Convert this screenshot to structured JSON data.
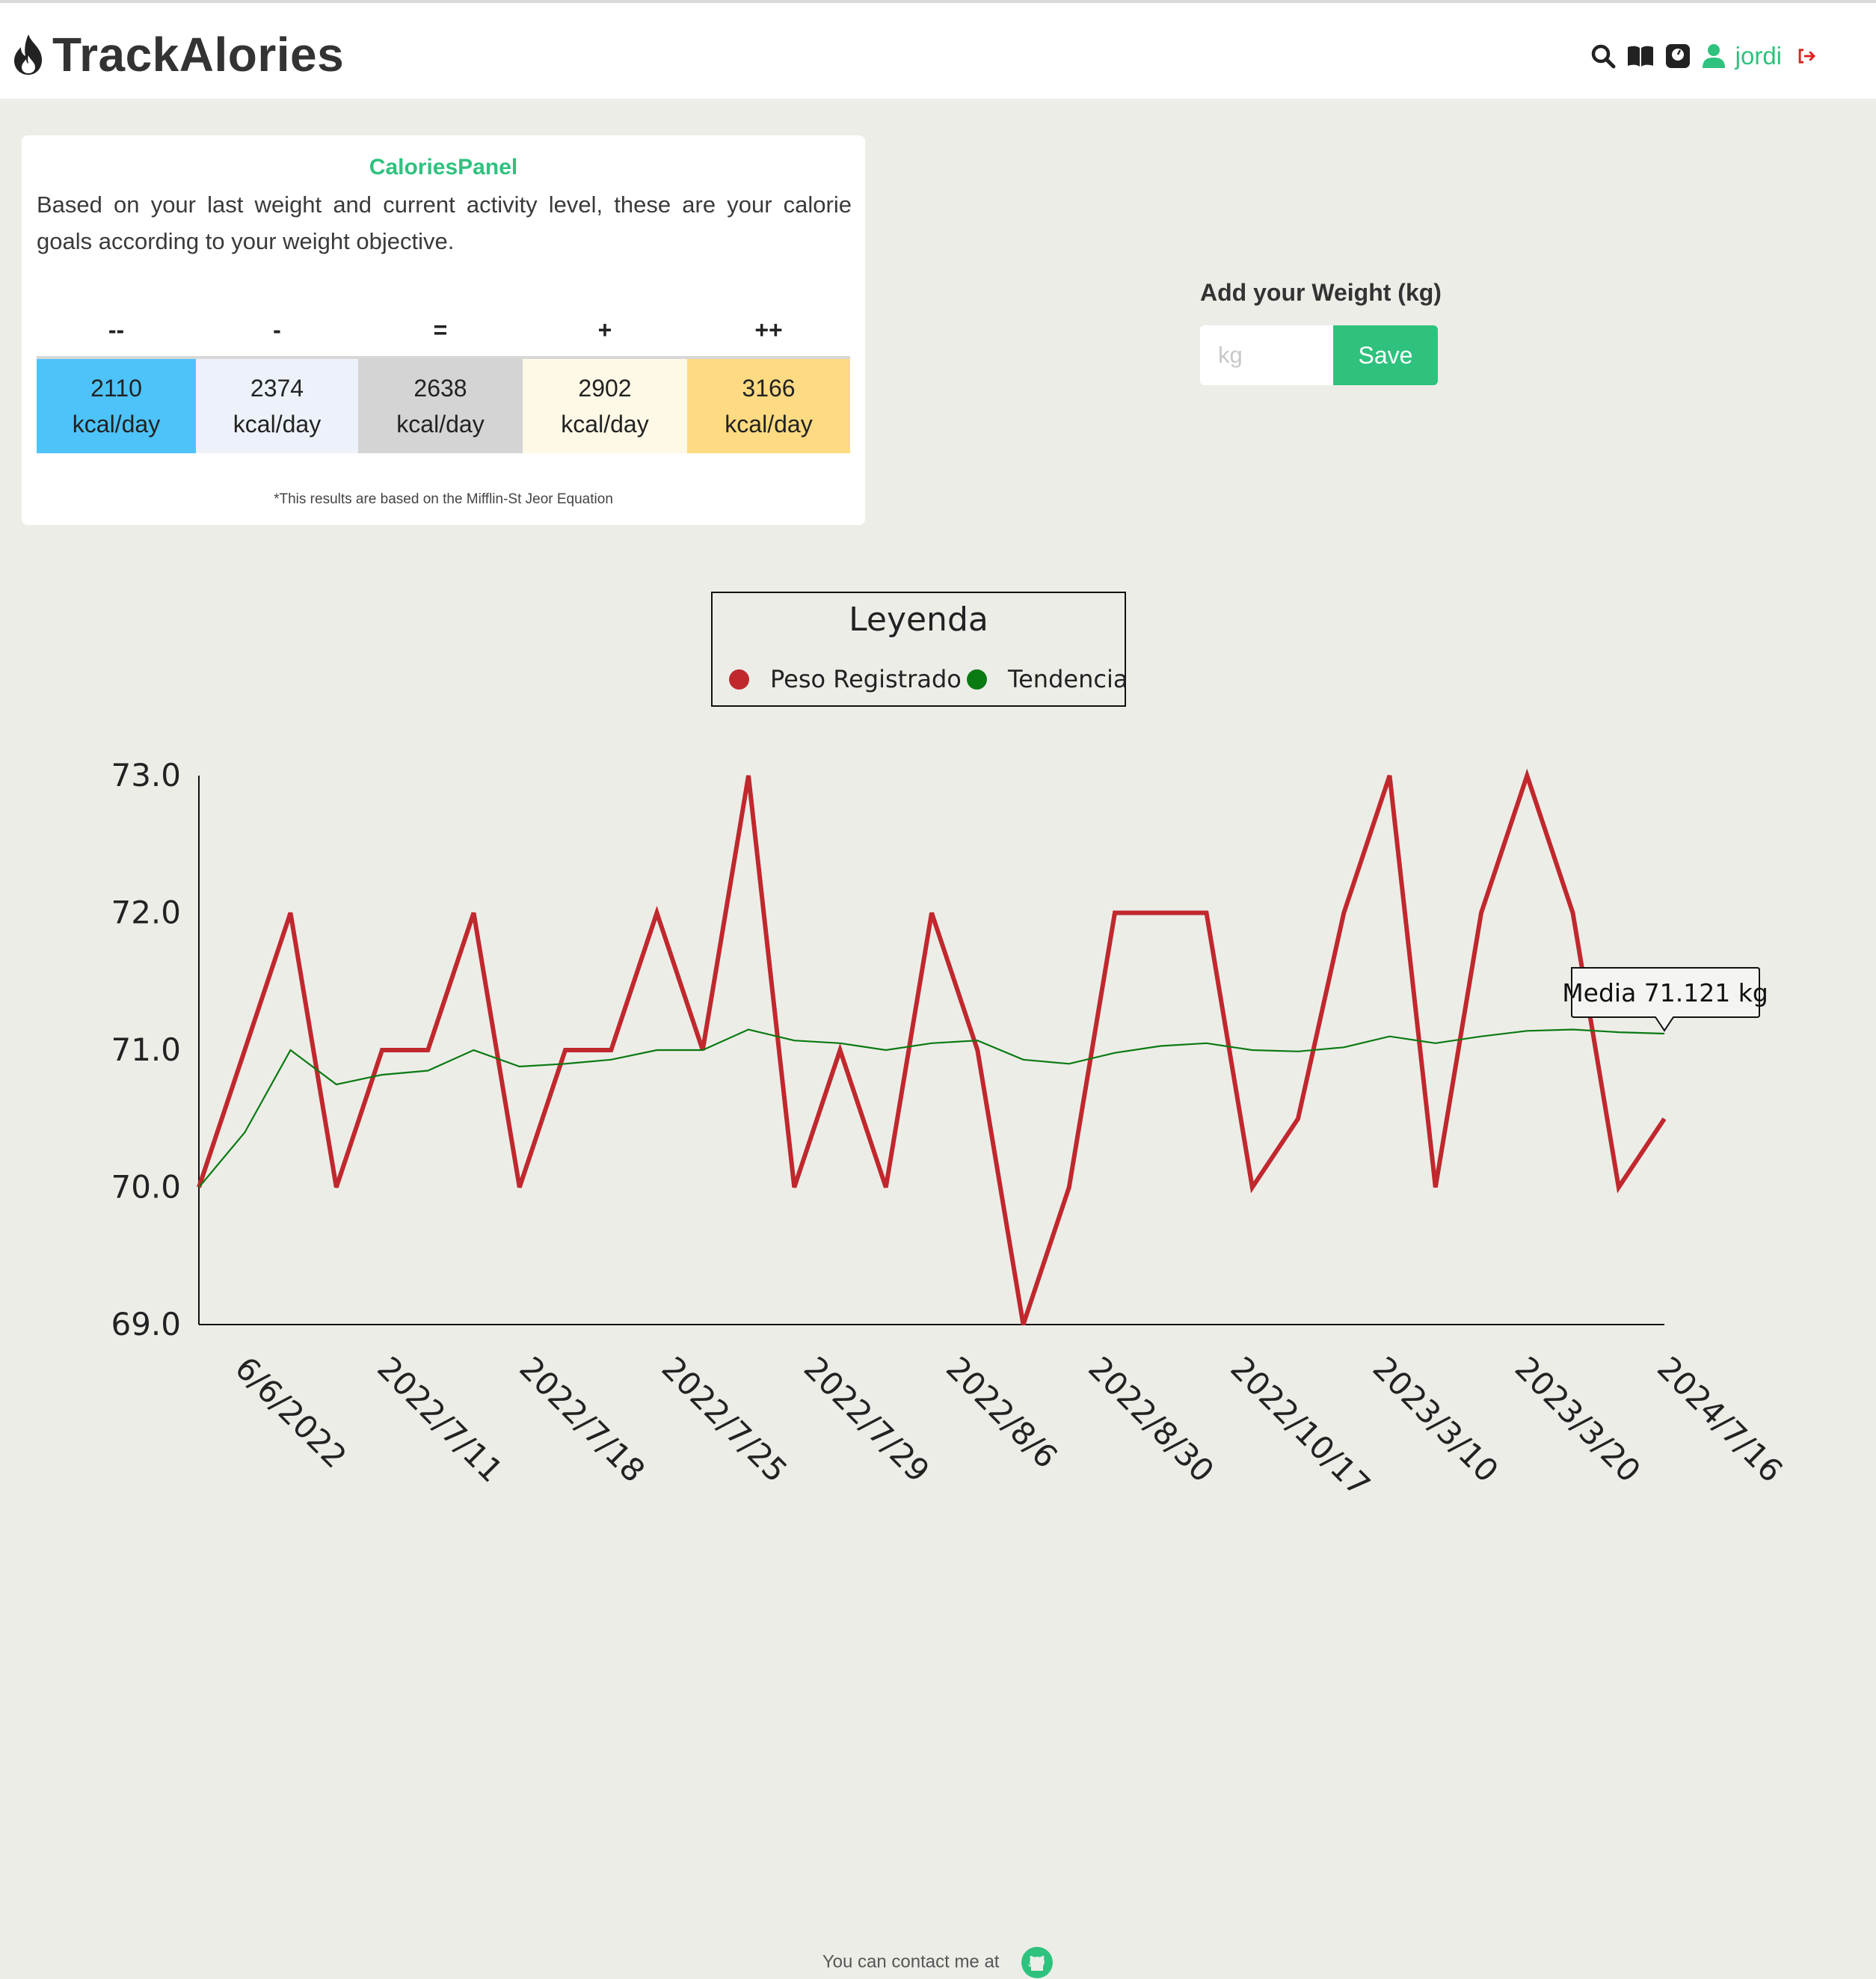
{
  "app": {
    "name": "TrackAlories",
    "logo_icon": "flame-icon"
  },
  "nav": {
    "icons": [
      "search-icon",
      "book-icon",
      "scale-icon",
      "user-icon"
    ],
    "username": "jordi",
    "logout_icon": "logout-icon"
  },
  "calories_panel": {
    "title": "CaloriesPanel",
    "description": "Based on your last weight and current activity level, these are your calorie goals according to your weight objective.",
    "goals": [
      {
        "symbol": "--",
        "value": "2110",
        "unit": "kcal/day",
        "color": "#4dc3fa"
      },
      {
        "symbol": "-",
        "value": "2374",
        "unit": "kcal/day",
        "color": "#edf2fa"
      },
      {
        "symbol": "=",
        "value": "2638",
        "unit": "kcal/day",
        "color": "#d4d4d4"
      },
      {
        "symbol": "+",
        "value": "2902",
        "unit": "kcal/day",
        "color": "#fef8e6"
      },
      {
        "symbol": "++",
        "value": "3166",
        "unit": "kcal/day",
        "color": "#fedb82"
      }
    ],
    "note": "*This results are based on the Mifflin-St Jeor Equation"
  },
  "weight_form": {
    "label": "Add your Weight (kg)",
    "placeholder": "kg",
    "value": "",
    "save_label": "Save"
  },
  "legend": {
    "title": "Leyenda",
    "items": [
      {
        "label": "Peso Registrado",
        "color": "#c0282d"
      },
      {
        "label": "Tendencia",
        "color": "#0a7a12"
      }
    ]
  },
  "chart_data": {
    "type": "line",
    "x_tick_labels": [
      "6/6/2022",
      "2022/7/11",
      "2022/7/18",
      "2022/7/25",
      "2022/7/29",
      "2022/8/6",
      "2022/8/30",
      "2022/10/17",
      "2023/3/10",
      "2023/3/20",
      "2024/7/16"
    ],
    "ylim": [
      69,
      73
    ],
    "yticks": [
      "73.0",
      "72.0",
      "71.0",
      "70.0",
      "69.0"
    ],
    "grid": false,
    "legend_position": "top",
    "series": [
      {
        "name": "Peso Registrado",
        "color": "#c0282d",
        "values": [
          70,
          71,
          72,
          70,
          71,
          71,
          72,
          70,
          71,
          71,
          72,
          71,
          73,
          70,
          71,
          70,
          72,
          71,
          69,
          70,
          72,
          72,
          72,
          70,
          70.5,
          72,
          73,
          70,
          72,
          73,
          72,
          70,
          70.5
        ]
      },
      {
        "name": "Tendencia",
        "color": "#0a7a12",
        "values": [
          70,
          70.4,
          71,
          70.75,
          70.82,
          70.85,
          71,
          70.88,
          70.9,
          70.93,
          71,
          71,
          71.15,
          71.07,
          71.05,
          71,
          71.05,
          71.07,
          70.93,
          70.9,
          70.98,
          71.03,
          71.05,
          71,
          70.99,
          71.02,
          71.1,
          71.05,
          71.1,
          71.14,
          71.15,
          71.13,
          71.12
        ]
      }
    ],
    "tooltip": "Media 71.121 kg"
  },
  "footer": {
    "text": "You can contact me at",
    "icon": "github-icon"
  }
}
